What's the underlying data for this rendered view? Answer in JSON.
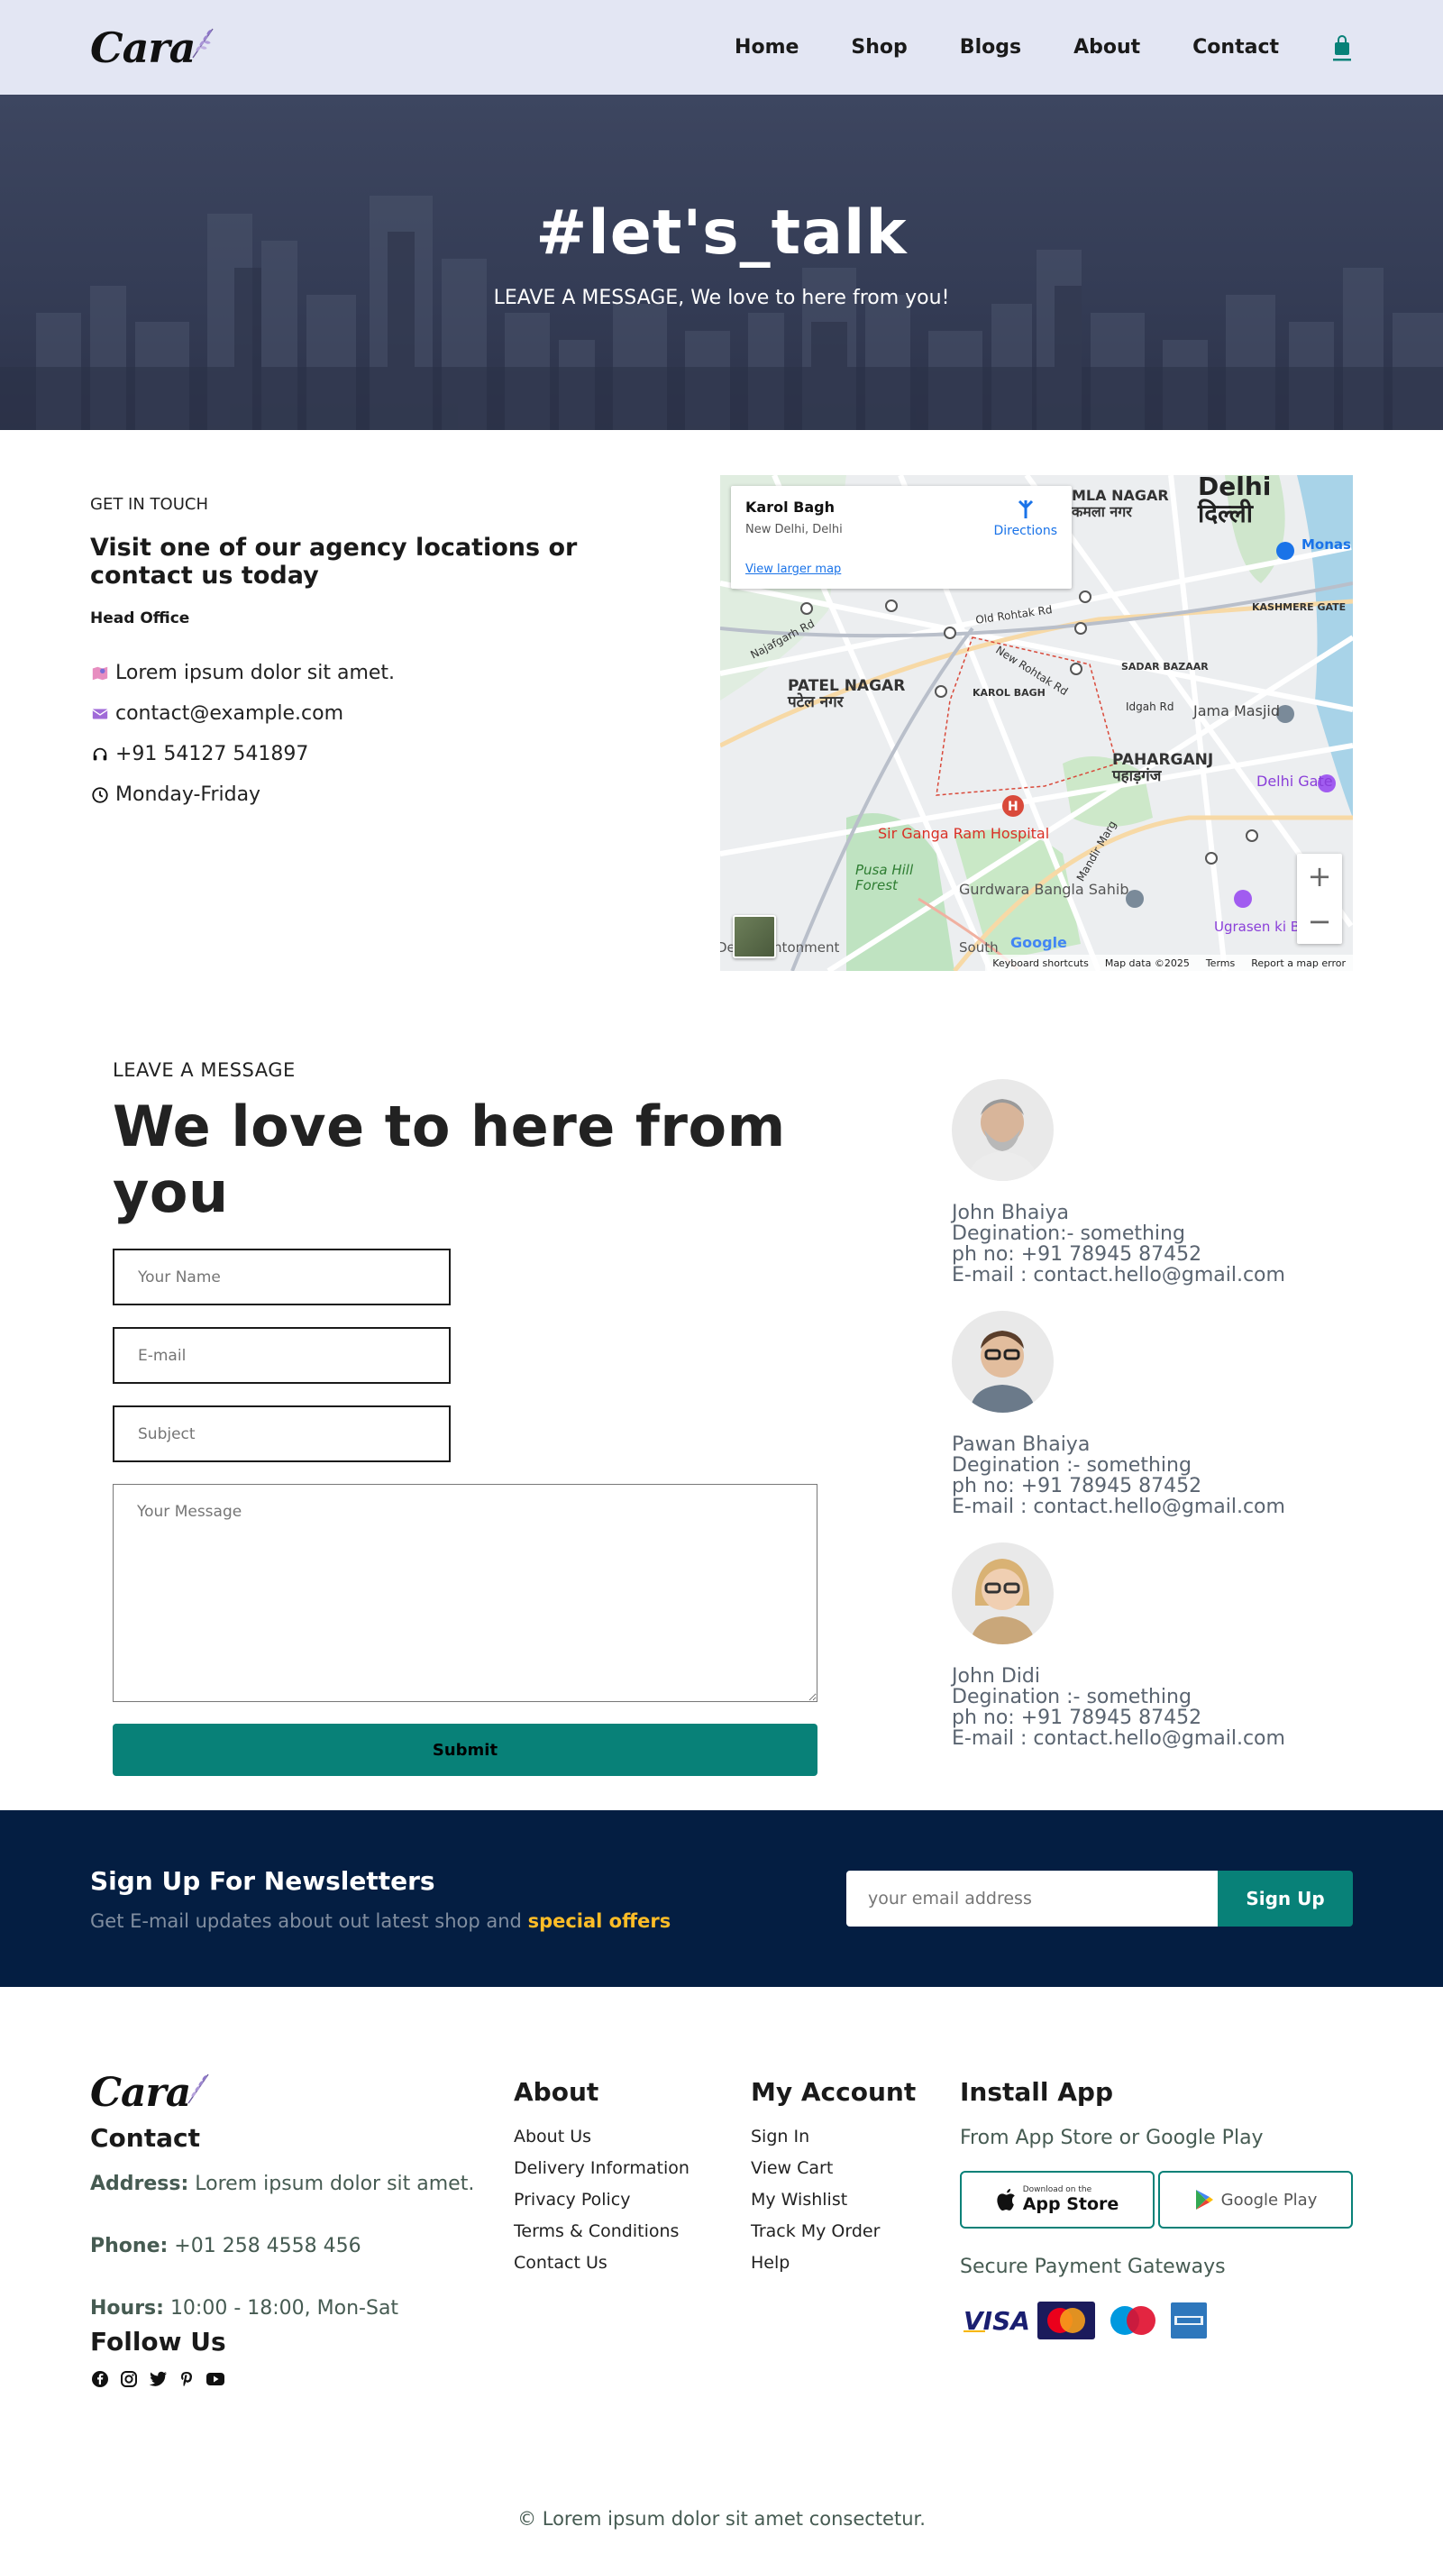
{
  "header": {
    "logo_text": "Cara",
    "nav": [
      "Home",
      "Shop",
      "Blogs",
      "About",
      "Contact"
    ],
    "accent": "#088178"
  },
  "hero": {
    "title": "#let's_talk",
    "subtitle": "LEAVE A MESSAGE, We love to here from you!"
  },
  "contact": {
    "eyebrow": "GET IN TOUCH",
    "title": "Visit one of our agency locations or contact us today",
    "office_label": "Head Office",
    "address": "Lorem ipsum dolor sit amet.",
    "email": "contact@example.com",
    "phone": "+91 54127 541897",
    "hours": "Monday-Friday"
  },
  "map": {
    "place": "Karol Bagh",
    "place_sub": "New Delhi, Delhi",
    "directions": "Directions",
    "larger": "View larger map",
    "zoom_in": "+",
    "zoom_out": "−",
    "keyboard": "Keyboard shortcuts",
    "mapdata": "Map data ©2025",
    "terms": "Terms",
    "report": "Report a map error",
    "google": "Google",
    "labels": {
      "delhi": "Delhi",
      "delhi_hi": "दिल्ली",
      "patel": "PATEL NAGAR",
      "patel_hi": "पटेल नगर",
      "paharganj": "PAHARGANJ",
      "paharganj_hi": "पहाड़गंज",
      "kamla": "MLA NAGAR",
      "kamla_hi": "कमला नगर",
      "hospital": "Sir Ganga Ram Hospital",
      "gurdwara": "Gurdwara Bangla Sahib",
      "jama": "Jama Masjid",
      "delhigate": "Delhi Gate",
      "pusa": "Pusa Hill Forest",
      "cantonment": "Delhi Cantonment",
      "ugrasen": "Ugrasen ki B",
      "kashmere": "KASHMERE GATE",
      "sadar": "SADAR BAZAAR",
      "oldrohtak": "Old Rohtak Rd",
      "newrohtak": "New Rohtak Rd",
      "najafgarh": "Najafgarh Rd",
      "idgah": "Idgah Rd",
      "mandir": "Mandir Marg",
      "karolbagh": "KAROL BAGH",
      "south": "South",
      "monas": "Monas"
    }
  },
  "form": {
    "eyebrow": "LEAVE A MESSAGE",
    "title": "We love to here from you",
    "name_ph": "Your Name",
    "email_ph": "E-mail",
    "subject_ph": "Subject",
    "message_ph": "Your Message",
    "submit": "Submit"
  },
  "people": [
    {
      "name": "John Bhaiya",
      "role": "Degination:- something",
      "phone": "ph no: +91 78945 87452",
      "email": "E-mail : contact.hello@gmail.com"
    },
    {
      "name": "Pawan Bhaiya",
      "role": "Degination :- something",
      "phone": "ph no: +91 78945 87452",
      "email": "E-mail : contact.hello@gmail.com"
    },
    {
      "name": "John Didi",
      "role": "Degination :- something",
      "phone": "ph no: +91 78945 87452",
      "email": "E-mail : contact.hello@gmail.com"
    }
  ],
  "newsletter": {
    "title": "Sign Up For Newsletters",
    "text": "Get E-mail updates about out latest shop and",
    "highlight": "special offers",
    "placeholder": "your email address",
    "button": "Sign Up"
  },
  "footer": {
    "logo_text": "Cara",
    "contact_title": "Contact",
    "address_label": "Address:",
    "address": "Lorem ipsum dolor sit amet.",
    "phone_label": "Phone:",
    "phone": "+01 258 4558 456",
    "hours_label": "Hours:",
    "hours": "10:00 - 18:00, Mon-Sat",
    "follow_title": "Follow Us",
    "about_title": "About",
    "about_links": [
      "About Us",
      "Delivery Information",
      "Privacy Policy",
      "Terms & Conditions",
      "Contact Us"
    ],
    "account_title": "My Account",
    "account_links": [
      "Sign In",
      "View Cart",
      "My Wishlist",
      "Track My Order",
      "Help"
    ],
    "install_title": "Install App",
    "install_sub": "From App Store or Google Play",
    "appstore_small": "Download on the",
    "appstore": "App Store",
    "googleplay": "Google Play",
    "secure": "Secure Payment Gateways",
    "copyright": "© Lorem ipsum dolor sit amet consectetur."
  }
}
